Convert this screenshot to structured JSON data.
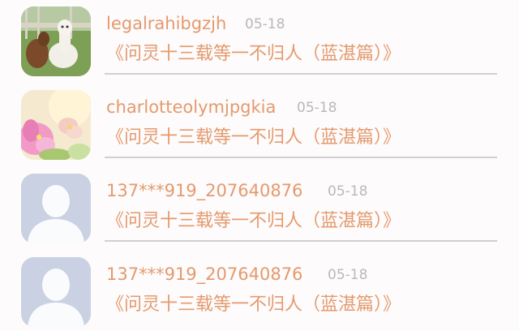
{
  "comments": [
    {
      "username": "legalrahibgzjh",
      "date": "05-18",
      "title": "《问灵十三载等一不归人（蓝湛篇）》",
      "avatar": "alpaca-photo-avatar"
    },
    {
      "username": "charlotteolymjpgkia",
      "date": "05-18",
      "title": "《问灵十三载等一不归人（蓝湛篇）》",
      "avatar": "flower-photo-avatar"
    },
    {
      "username": "137***919_207640876",
      "date": "05-18",
      "title": "《问灵十三载等一不归人（蓝湛篇）》",
      "avatar": "default-user-avatar"
    },
    {
      "username": "137***919_207640876",
      "date": "05-18",
      "title": "《问灵十三载等一不归人（蓝湛篇）》",
      "avatar": "default-user-avatar"
    }
  ],
  "colors": {
    "accent_text": "#e49a6e",
    "date_text": "#b9b9b9",
    "divider": "#d0d0d0",
    "default_avatar_bg": "#c9d1e3",
    "background": "#fdfbfb"
  }
}
